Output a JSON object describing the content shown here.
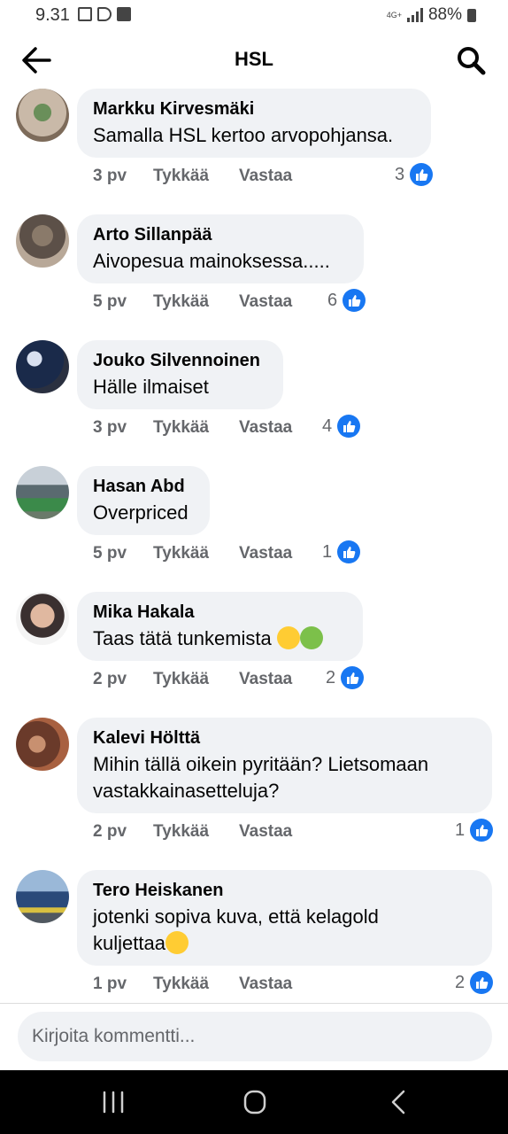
{
  "status": {
    "time": "9.31",
    "network": "4G+",
    "battery": "88%"
  },
  "header": {
    "title": "HSL"
  },
  "comments": [
    {
      "author": "Markku Kirvesmäki",
      "text": "Samalla HSL kertoo arvopohjansa.",
      "age": "3 pv",
      "like": "Tykkää",
      "reply": "Vastaa",
      "likes": "3"
    },
    {
      "author": "Arto Sillanpää",
      "text": "Aivopesua mainoksessa.....",
      "age": "5 pv",
      "like": "Tykkää",
      "reply": "Vastaa",
      "likes": "6"
    },
    {
      "author": "Jouko Silvennoinen",
      "text": "Hälle ilmaiset",
      "age": "3 pv",
      "like": "Tykkää",
      "reply": "Vastaa",
      "likes": "4"
    },
    {
      "author": "Hasan Abd",
      "text": "Overpriced",
      "age": "5 pv",
      "like": "Tykkää",
      "reply": "Vastaa",
      "likes": "1"
    },
    {
      "author": "Mika Hakala",
      "text": "Taas tätä tunkemista",
      "age": "2 pv",
      "like": "Tykkää",
      "reply": "Vastaa",
      "likes": "2"
    },
    {
      "author": "Kalevi Hölttä",
      "text_line1": "Mihin tällä oikein pyritään? Lietsomaan",
      "text_line2": "vastakkainasetteluja?",
      "age": "2 pv",
      "like": "Tykkää",
      "reply": "Vastaa",
      "likes": "1"
    },
    {
      "author": "Tero Heiskanen",
      "text_line1": "jotenki sopiva kuva, että kelagold",
      "text_line2": "kuljettaa",
      "age": "1 pv",
      "like": "Tykkää",
      "reply": "Vastaa",
      "likes": "2"
    }
  ],
  "composer": {
    "placeholder": "Kirjoita kommentti..."
  },
  "colors": {
    "accent": "#1877f2",
    "bubble": "#f0f2f5",
    "meta": "#65676b"
  },
  "icons": {
    "back": "arrow-left-icon",
    "search": "search-icon",
    "like": "thumbs-up-icon"
  }
}
